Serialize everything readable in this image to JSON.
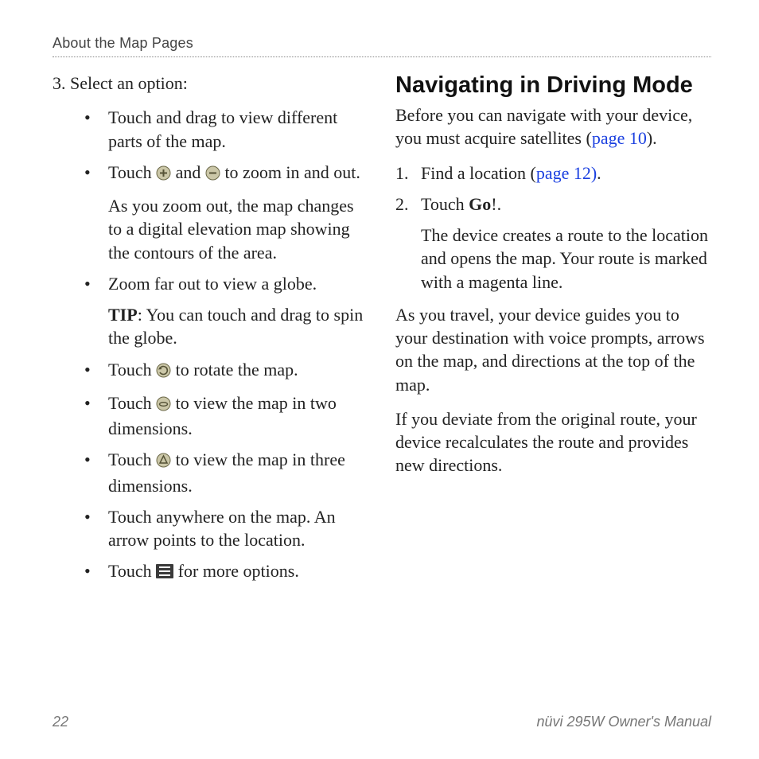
{
  "runningHead": "About the Map Pages",
  "left": {
    "step3Lead": "3. Select an option:",
    "b1": "Touch and drag to view different parts of the map.",
    "b2a": "Touch ",
    "b2b": " and ",
    "b2c": " to zoom in and out.",
    "b2_follow": "As you zoom out, the map changes to a digital elevation map showing the contours of the area.",
    "b3": "Zoom far out to view a globe.",
    "b3_tip_label": "TIP",
    "b3_tip_rest": ": You can touch and drag to spin the globe.",
    "b4a": "Touch ",
    "b4b": " to rotate the map.",
    "b5a": "Touch ",
    "b5b": " to view the map in two dimensions.",
    "b6a": "Touch ",
    "b6b": " to view the map in three dimensions.",
    "b7": "Touch anywhere on the map. An arrow points to the location.",
    "b8a": "Touch ",
    "b8b": " for more options."
  },
  "right": {
    "heading": "Navigating in Driving Mode",
    "intro_a": "Before you can navigate with your device, you must acquire satellites (",
    "intro_link": "page 10",
    "intro_b": ").",
    "li1_num": "1.",
    "li1_a": "Find a location (",
    "li1_link": "page 12)",
    "li1_b": ".",
    "li2_num": "2.",
    "li2_a": "Touch ",
    "li2_bold": "Go",
    "li2_b": "!.",
    "li2_follow": "The device creates a route to the location and opens the map. Your route is marked with a magenta line.",
    "para2": "As you travel, your device guides you to your destination with voice prompts, arrows on the map, and directions at the top of the map.",
    "para3": "If you deviate from the original route, your device recalculates the route and provides new directions."
  },
  "footer": {
    "page": "22",
    "title": "nüvi 295W Owner's Manual"
  }
}
